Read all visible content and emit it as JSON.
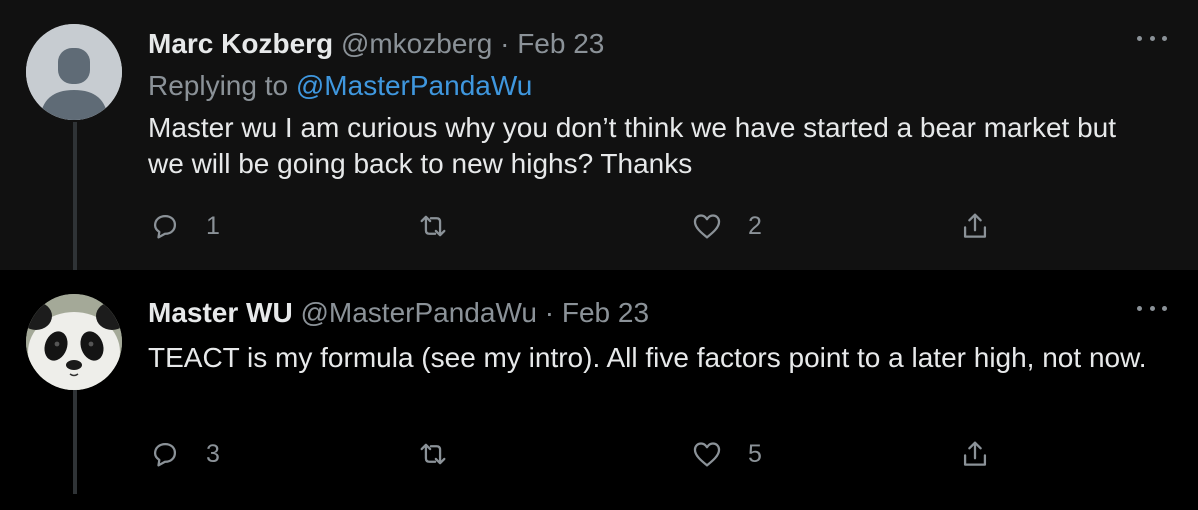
{
  "tweets": [
    {
      "name": "Marc Kozberg",
      "handle": "@mkozberg",
      "separator": "·",
      "date": "Feb 23",
      "replying_to_label": "Replying to",
      "replying_to_handle": "@MasterPandaWu",
      "text": "Master wu I am curious why you don’t think we have started a bear market but we will be going back to new highs? Thanks",
      "replies": "1",
      "retweets": "",
      "likes": "2"
    },
    {
      "name": "Master WU",
      "handle": "@MasterPandaWu",
      "separator": "·",
      "date": "Feb 23",
      "text": "TEACT is my formula (see my intro). All five factors point to a later high, not now.",
      "replies": "3",
      "retweets": "",
      "likes": "5"
    }
  ],
  "colors": {
    "background": "#000000",
    "highlight_background": "#111111",
    "text": "#e7e9ea",
    "muted": "#8b9298",
    "link": "#3f97de"
  },
  "icons": [
    "reply-icon",
    "retweet-icon",
    "like-icon",
    "share-icon",
    "more-icon",
    "default-avatar-icon",
    "panda-avatar"
  ]
}
